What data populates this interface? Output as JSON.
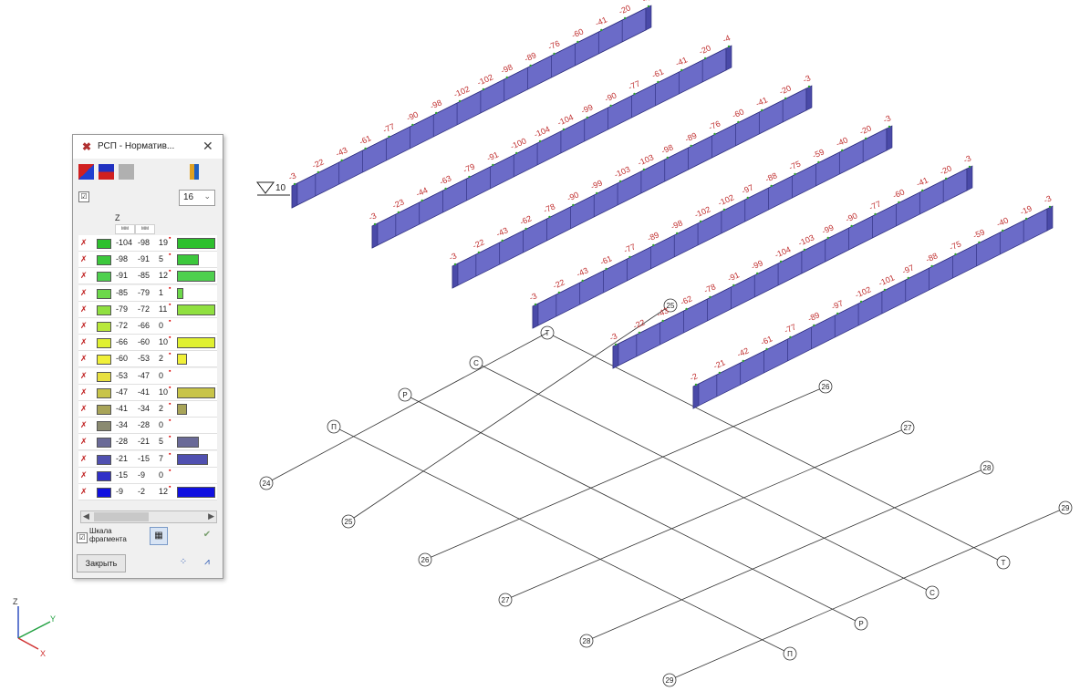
{
  "window": {
    "title": "РСП - Норматив...",
    "close_glyph": "✕",
    "app_icon": "rsp-app-icon",
    "toolbar": [
      "color-scale-red-blue-icon",
      "color-scale-blue-red-icon",
      "color-scale-gray-icon",
      "chart-settings-icon"
    ],
    "checkbox_glyph": "☑",
    "interval_count": "16",
    "column_header": "Z",
    "column_subheaders": [
      "мм",
      "мм"
    ],
    "rows": [
      {
        "from": "-104",
        "to": "-98",
        "count": "19",
        "color": "#2ec02e",
        "fill": 1.0
      },
      {
        "from": "-98",
        "to": "-91",
        "count": "5",
        "color": "#3cc83c",
        "fill": 0.55
      },
      {
        "from": "-91",
        "to": "-85",
        "count": "12",
        "color": "#4ed04e",
        "fill": 1.0
      },
      {
        "from": "-85",
        "to": "-79",
        "count": "1",
        "color": "#6cd84a",
        "fill": 0.12
      },
      {
        "from": "-79",
        "to": "-72",
        "count": "11",
        "color": "#90e040",
        "fill": 1.0
      },
      {
        "from": "-72",
        "to": "-66",
        "count": "0",
        "color": "#b8e83a",
        "fill": 0
      },
      {
        "from": "-66",
        "to": "-60",
        "count": "10",
        "color": "#e0f030",
        "fill": 1.0
      },
      {
        "from": "-60",
        "to": "-53",
        "count": "2",
        "color": "#f0f038",
        "fill": 0.22
      },
      {
        "from": "-53",
        "to": "-47",
        "count": "0",
        "color": "#e8e040",
        "fill": 0
      },
      {
        "from": "-47",
        "to": "-41",
        "count": "10",
        "color": "#c8c448",
        "fill": 1.0
      },
      {
        "from": "-41",
        "to": "-34",
        "count": "2",
        "color": "#a8a458",
        "fill": 0.22
      },
      {
        "from": "-34",
        "to": "-28",
        "count": "0",
        "color": "#8a8a70",
        "fill": 0
      },
      {
        "from": "-28",
        "to": "-21",
        "count": "5",
        "color": "#6a6a98",
        "fill": 0.55
      },
      {
        "from": "-21",
        "to": "-15",
        "count": "7",
        "color": "#5050b0",
        "fill": 0.8
      },
      {
        "from": "-15",
        "to": "-9",
        "count": "0",
        "color": "#3030c8",
        "fill": 0
      },
      {
        "from": "-9",
        "to": "-2",
        "count": "12",
        "color": "#1010e0",
        "fill": 1.0
      }
    ],
    "scale_fragment_label": "Шкала\nфрагмента",
    "close_label": "Закрыть",
    "apply_icon": "check-icon"
  },
  "scene": {
    "level_mark": "10",
    "beams": [
      {
        "labels": [
          "-3",
          "-22",
          "-43",
          "-61",
          "-77",
          "-90",
          "-98",
          "-102",
          "-102",
          "-98",
          "-89",
          "-76",
          "-60",
          "-41",
          "-20",
          "-4"
        ]
      },
      {
        "labels": [
          "-3",
          "-23",
          "-44",
          "-63",
          "-79",
          "-91",
          "-100",
          "-104",
          "-104",
          "-99",
          "-90",
          "-77",
          "-61",
          "-41",
          "-20",
          "-4"
        ]
      },
      {
        "labels": [
          "-3",
          "-22",
          "-43",
          "-62",
          "-78",
          "-90",
          "-99",
          "-103",
          "-103",
          "-98",
          "-89",
          "-76",
          "-60",
          "-41",
          "-20",
          "-3"
        ]
      },
      {
        "labels": [
          "-3",
          "-22",
          "-43",
          "-61",
          "-77",
          "-89",
          "-98",
          "-102",
          "-102",
          "-97",
          "-88",
          "-75",
          "-59",
          "-40",
          "-20",
          "-3"
        ]
      },
      {
        "labels": [
          "-3",
          "-22",
          "-43",
          "-62",
          "-78",
          "-91",
          "-99",
          "-104",
          "-103",
          "-99",
          "-90",
          "-77",
          "-60",
          "-41",
          "-20",
          "-3"
        ]
      },
      {
        "labels": [
          "-2",
          "-21",
          "-42",
          "-61",
          "-77",
          "-89",
          "-97",
          "-102",
          "-101",
          "-97",
          "-88",
          "-75",
          "-59",
          "-40",
          "-19",
          "-3"
        ]
      }
    ],
    "axis_letters": [
      "Т",
      "С",
      "Р",
      "П"
    ],
    "axis_numbers": [
      "24",
      "25",
      "26",
      "27",
      "28",
      "29"
    ],
    "coord_axes": [
      "Z",
      "Y",
      "X"
    ],
    "colors": {
      "beam_face": "#6b6bc8",
      "beam_top": "#8c8cdc",
      "beam_edge": "#2a2a7a",
      "label": "#c03030",
      "grid": "#333333"
    }
  }
}
